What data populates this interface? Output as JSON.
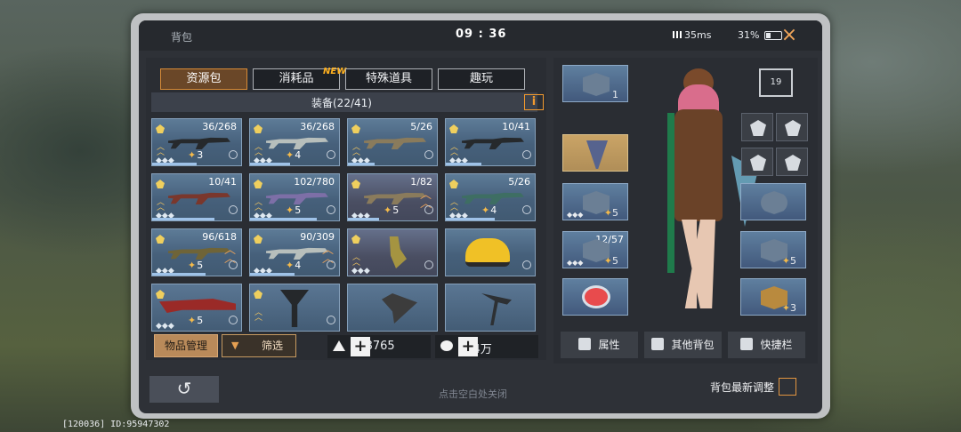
{
  "app": {
    "title": "背包",
    "time": "09 : 36",
    "ping": "35ms",
    "battery": "31%",
    "close_glyph": "×"
  },
  "tabs": [
    {
      "label": "资源包",
      "active": true
    },
    {
      "label": "消耗品",
      "badge": "NEW"
    },
    {
      "label": "特殊道具"
    },
    {
      "label": "趣玩"
    }
  ],
  "equipment": {
    "label": "装备(22/41)",
    "info_glyph": "i"
  },
  "items": [
    {
      "count": "36/268",
      "level": "3"
    },
    {
      "count": "36/268",
      "level": "4"
    },
    {
      "count": "5/26",
      "level": ""
    },
    {
      "count": "10/41",
      "level": ""
    },
    {
      "count": "10/41",
      "level": ""
    },
    {
      "count": "102/780",
      "level": "5"
    },
    {
      "count": "1/82",
      "level": "5"
    },
    {
      "count": "5/26",
      "level": "4"
    },
    {
      "count": "96/618",
      "level": "5"
    },
    {
      "count": "90/309",
      "level": "4"
    },
    {
      "count": "",
      "level": ""
    },
    {
      "count": "",
      "level": ""
    },
    {
      "count": "",
      "level": "5"
    },
    {
      "count": "",
      "level": ""
    },
    {
      "count": "",
      "level": ""
    },
    {
      "count": "",
      "level": ""
    }
  ],
  "actions": {
    "manage": "物品管理",
    "filter": "筛选"
  },
  "currency": [
    {
      "value": "168765"
    },
    {
      "value": "644万"
    }
  ],
  "hint": "点击空白处关闭",
  "right": {
    "rank_value": "19",
    "slot_counts": [
      "12/57"
    ],
    "slot_levels": [
      "1",
      "5",
      "5",
      "5",
      "3"
    ],
    "buttons": [
      "属性",
      "其他背包",
      "快捷栏"
    ],
    "latest": "背包最新调整"
  },
  "footer": {
    "device_id": "[120036] ID:95947302"
  }
}
